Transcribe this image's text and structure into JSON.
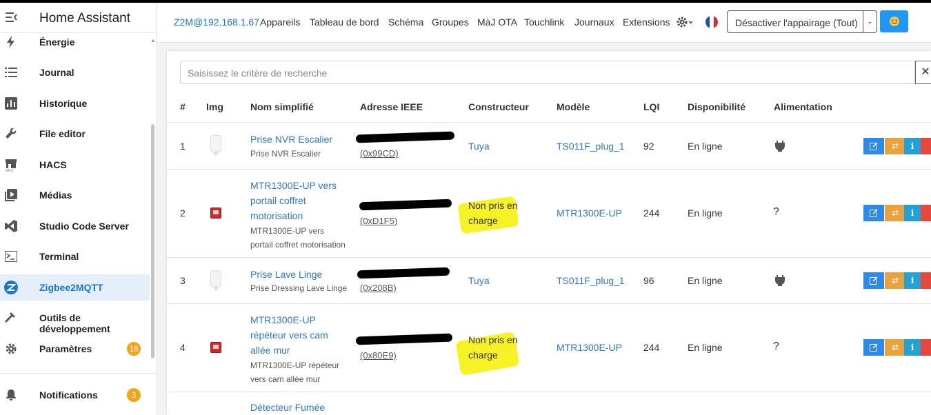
{
  "sidebar": {
    "title": "Home Assistant",
    "items": [
      {
        "label": "Énergie"
      },
      {
        "label": "Journal"
      },
      {
        "label": "Historique"
      },
      {
        "label": "File editor"
      },
      {
        "label": "HACS"
      },
      {
        "label": "Médias"
      },
      {
        "label": "Studio Code Server"
      },
      {
        "label": "Terminal"
      },
      {
        "label": "Zigbee2MQTT"
      },
      {
        "label": "Outils de développement"
      },
      {
        "label": "Paramètres",
        "badge": "16"
      },
      {
        "label": "Notifications",
        "badge": "3"
      }
    ]
  },
  "topnav": {
    "brand": "Z2M@192.168.1.67",
    "links": [
      "Appareils",
      "Tableau de bord",
      "Schéma",
      "Groupes",
      "MàJ OTA",
      "Touchlink",
      "Journaux",
      "Extensions"
    ],
    "pairing_select": "Désactiver l'appairage (Tout)"
  },
  "search": {
    "placeholder": "Saisissez le critère de recherche"
  },
  "table": {
    "headers": [
      "#",
      "Img",
      "Nom simplifié",
      "Adresse IEEE",
      "Constructeur",
      "Modèle",
      "LQI",
      "Disponibilité",
      "Alimentation"
    ],
    "rows": [
      {
        "num": "1",
        "name": "Prise NVR Escalier",
        "desc": "Prise NVR Escalier",
        "ieee": "(0x99CD)",
        "vendor": "Tuya",
        "model": "TS011F_plug_1",
        "lqi": "92",
        "availability": "En ligne",
        "power": "plug"
      },
      {
        "num": "2",
        "name": "MTR1300E-UP vers portail coffret motorisation",
        "desc": "MTR1300E-UP vers portail coffret motorisation",
        "ieee": "(0xD1F5)",
        "vendor": "Non pris en charge",
        "model": "MTR1300E-UP",
        "lqi": "244",
        "availability": "En ligne",
        "power": "?"
      },
      {
        "num": "3",
        "name": "Prise Lave Linge",
        "desc": "Prise Dressing Lave Linge",
        "ieee": "(0x208B)",
        "vendor": "Tuya",
        "model": "TS011F_plug_1",
        "lqi": "96",
        "availability": "En ligne",
        "power": "plug"
      },
      {
        "num": "4",
        "name": "MTR1300E-UP répéteur vers cam allée mur",
        "desc": "MTR1300E-UP répéteur vers cam allée mur",
        "ieee": "(0x80E9)",
        "vendor": "Non pris en charge",
        "model": "MTR1300E-UP",
        "lqi": "244",
        "availability": "En ligne",
        "power": "?"
      },
      {
        "num": "",
        "name": "Détecteur Fumée"
      }
    ]
  },
  "colors": {
    "accent": "#1976d2",
    "link": "#2f77c5",
    "badge": "#f2a31a",
    "highlight": "#f6f000"
  }
}
